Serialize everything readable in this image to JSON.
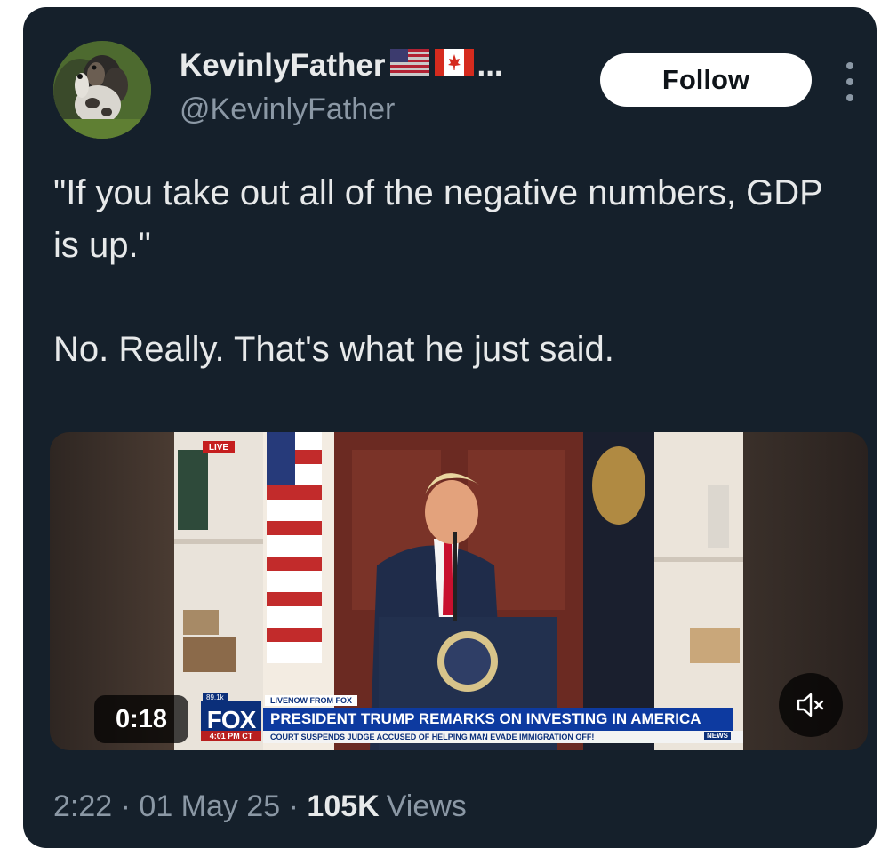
{
  "author": {
    "display_name": "KevinlyFather",
    "name_overflow": "...",
    "handle": "@KevinlyFather",
    "flags": [
      "us-flag-icon",
      "canada-flag-icon"
    ]
  },
  "follow_label": "Follow",
  "tweet": {
    "line1": "\"If you take out all of the negative numbers, GDP is up.\"",
    "line2": "No. Really. That's what he just said."
  },
  "video": {
    "duration": "0:18",
    "live_tag": "LIVE",
    "network": "FOX",
    "views_badge": "89.1k",
    "time_badge": "4:01 PM CT",
    "live_now_label": "LIVENOW FROM FOX",
    "headline": "PRESIDENT TRUMP REMARKS ON INVESTING IN AMERICA",
    "ticker": "COURT SUSPENDS JUDGE ACCUSED OF HELPING MAN EVADE IMMIGRATION OFF!",
    "ticker_tag": "NEWS"
  },
  "meta": {
    "time": "2:22",
    "separator": "·",
    "date": "01 May 25",
    "view_count": "105K",
    "views_label": "Views"
  },
  "colors": {
    "card_bg": "#15202b",
    "primary_text": "#e7e9ea",
    "secondary_text": "#8b98a5",
    "follow_bg": "#ffffff",
    "fox_blue": "#0d3aa0"
  }
}
